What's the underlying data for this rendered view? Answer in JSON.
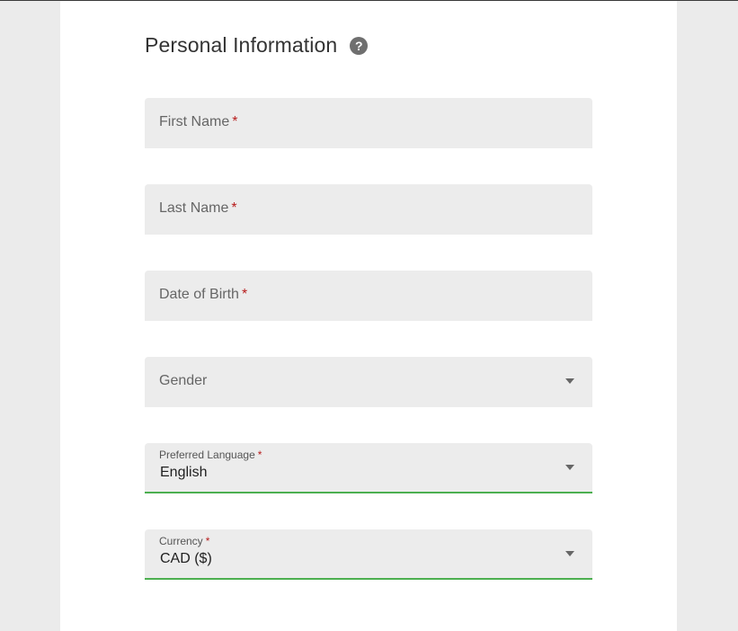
{
  "section": {
    "title": "Personal Information",
    "help_icon": "?"
  },
  "required_marker": "*",
  "fields": {
    "first_name": {
      "label": "First Name",
      "required": true,
      "value": ""
    },
    "last_name": {
      "label": "Last Name",
      "required": true,
      "value": ""
    },
    "date_of_birth": {
      "label": "Date of Birth",
      "required": true,
      "value": ""
    },
    "gender": {
      "label": "Gender",
      "required": false,
      "value": ""
    },
    "preferred_language": {
      "label": "Preferred Language",
      "required": true,
      "value": "English"
    },
    "currency": {
      "label": "Currency",
      "required": true,
      "value": "CAD ($)"
    }
  },
  "colors": {
    "page_background": "#ebebeb",
    "card_background": "#ffffff",
    "field_background": "#ececec",
    "focus_underline": "#4caf50",
    "required_marker": "#b71c1c"
  },
  "icons": [
    "help-icon",
    "dropdown-caret-icon"
  ]
}
